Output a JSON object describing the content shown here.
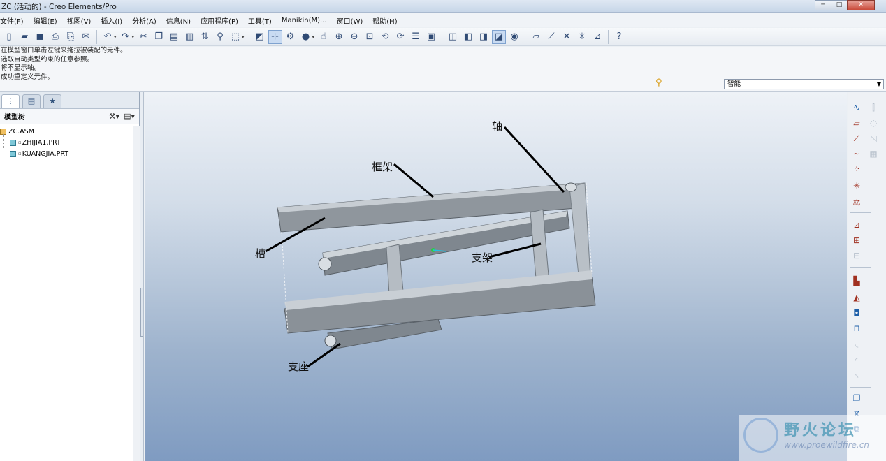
{
  "window": {
    "title": "ZC (活动的) - Creo Elements/Pro",
    "min_label": "─",
    "max_label": "□",
    "close_label": "✕"
  },
  "menu": [
    "文件(F)",
    "编辑(E)",
    "视图(V)",
    "插入(I)",
    "分析(A)",
    "信息(N)",
    "应用程序(P)",
    "工具(T)",
    "Manikin(M)...",
    "窗口(W)",
    "帮助(H)"
  ],
  "messages": [
    "在模型窗口单击左键来拖拉被装配的元件。",
    "选取自动类型约束的任意参照。",
    "将不显示轴。",
    "成功重定义元件。"
  ],
  "filter": {
    "value": "智能"
  },
  "model_tree": {
    "header": "模型树",
    "root": "ZC.ASM",
    "children": [
      "ZHIJIA1.PRT",
      "KUANGJIA.PRT"
    ]
  },
  "annotations": {
    "axis": "轴",
    "frame": "框架",
    "slot": "槽",
    "bracket": "支架",
    "base": "支座"
  },
  "watermark": {
    "text": "野火论坛",
    "url": "www.proewildfire.cn"
  }
}
